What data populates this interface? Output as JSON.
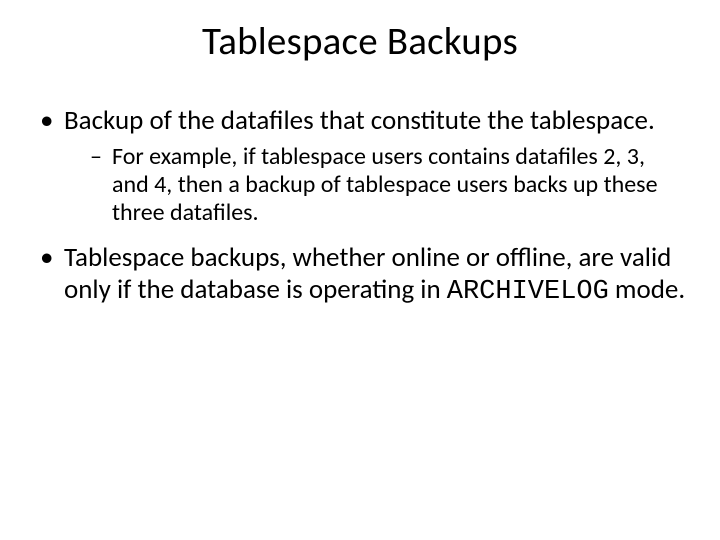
{
  "title": "Tablespace Backups",
  "bullets": {
    "b1": "Backup of the datafiles that constitute the tablespace.",
    "b1_sub1": "For example, if tablespace users contains datafiles 2, 3, and 4, then a backup of tablespace users backs up these three datafiles.",
    "b2_pre": "Tablespace backups, whether online or offline, are valid only if the database is operating in ",
    "b2_code": "ARCHIVELOG",
    "b2_post": " mode."
  }
}
